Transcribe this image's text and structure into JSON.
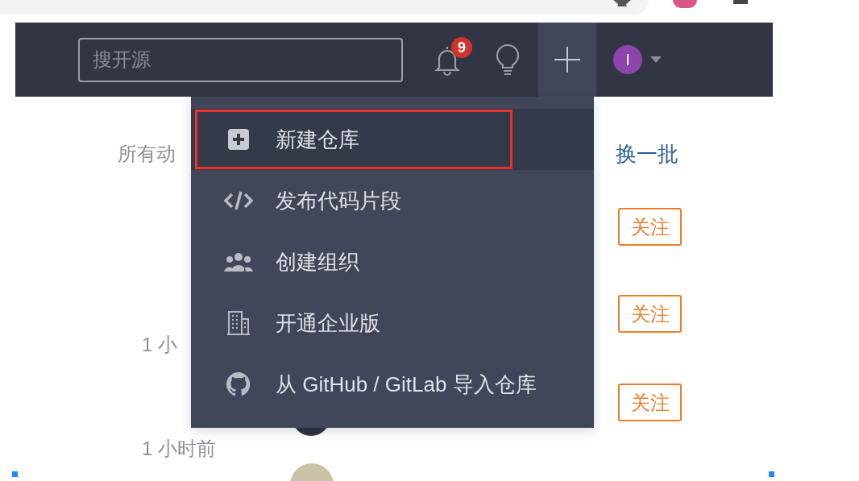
{
  "header": {
    "search": {
      "placeholder": "搜开源"
    },
    "notifications": {
      "count": "9"
    },
    "avatar": {
      "initial": "I"
    }
  },
  "create_menu": {
    "items": [
      {
        "label": "新建仓库",
        "selected": true,
        "annotated": true
      },
      {
        "label": "发布代码片段",
        "selected": false,
        "annotated": false
      },
      {
        "label": "创建组织",
        "selected": false,
        "annotated": false
      },
      {
        "label": "开通企业版",
        "selected": false,
        "annotated": false
      },
      {
        "label": "从 GitHub / GitLab 导入仓库",
        "selected": false,
        "annotated": false
      }
    ]
  },
  "feed": {
    "title": "所有动",
    "refresh": "换一批",
    "follow_buttons": [
      "关注",
      "关注",
      "关注"
    ],
    "times": [
      "1 小",
      "1 小时前"
    ]
  }
}
